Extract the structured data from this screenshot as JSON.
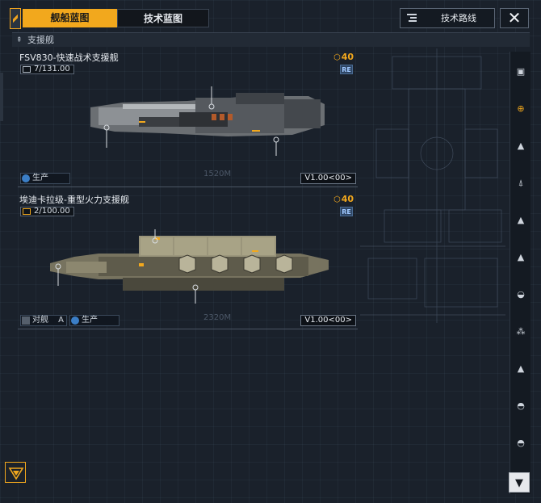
{
  "tabs": {
    "ship_blueprint": "舰船蓝图",
    "tech_blueprint": "技术蓝图"
  },
  "header": {
    "tech_route": "技术路线",
    "close": "✕"
  },
  "category": {
    "label": "支援舰"
  },
  "cards": [
    {
      "name": "FSV830-快速战术支援舰",
      "value": "7/131.00",
      "cost": "40",
      "re_badge": "RE",
      "production": "生产",
      "version": "V1.00<00>",
      "length_label": "1520M"
    },
    {
      "name": "埃迪卡拉级-重型火力支援舰",
      "value": "2/100.00",
      "cost": "40",
      "re_badge": "RE",
      "anti_ship_label": "对舰",
      "anti_ship_grade": "A",
      "production": "生产",
      "version": "V1.00<00>",
      "length_label": "2320M"
    }
  ],
  "rail_icons": [
    "flagship-icon",
    "support-icon",
    "frigate-icon",
    "destroyer-icon",
    "cruiser-icon",
    "battlecruiser-icon",
    "carrier-icon",
    "corvette-icon",
    "auxiliary-icon",
    "dreadnought-icon",
    "station-icon"
  ],
  "colors": {
    "accent": "#f2a81d",
    "background": "#1a212b",
    "re_badge": "#2f4664"
  }
}
